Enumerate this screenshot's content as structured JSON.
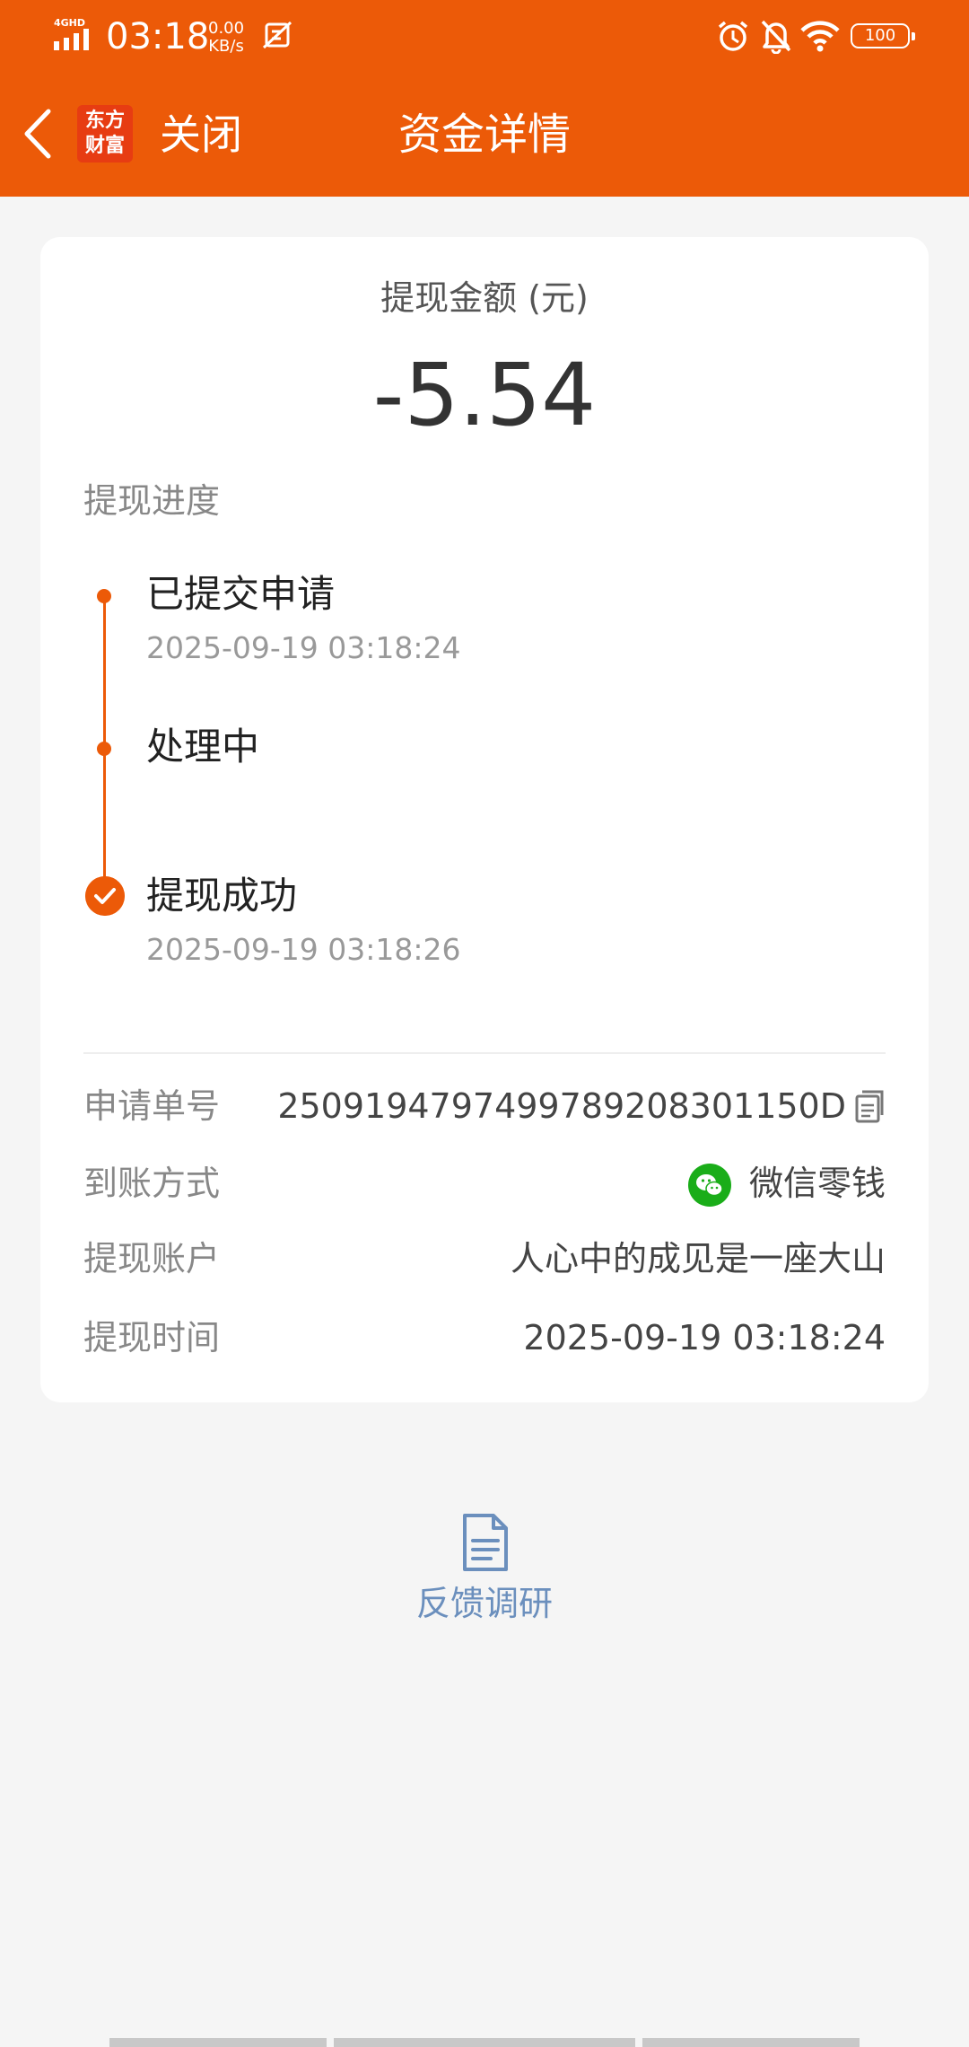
{
  "status_bar": {
    "network": "4GHD",
    "time": "03:18",
    "speed_value": "0.00",
    "speed_unit": "KB/s",
    "battery": "100"
  },
  "nav": {
    "logo_line1": "东方",
    "logo_line2": "财富",
    "close_label": "关闭",
    "title": "资金详情"
  },
  "withdraw": {
    "amount_label": "提现金额 (元)",
    "amount": "-5.54",
    "progress_title": "提现进度",
    "steps": [
      {
        "label": "已提交申请",
        "time": "2025-09-19 03:18:24"
      },
      {
        "label": "处理中",
        "time": ""
      },
      {
        "label": "提现成功",
        "time": "2025-09-19 03:18:26"
      }
    ]
  },
  "details": {
    "order_no_label": "申请单号",
    "order_no": "2509194797499789208301150D",
    "method_label": "到账方式",
    "method": "微信零钱",
    "account_label": "提现账户",
    "account": "人心中的成见是一座大山",
    "time_label": "提现时间",
    "time": "2025-09-19 03:18:24"
  },
  "feedback": {
    "label": "反馈调研"
  },
  "colors": {
    "accent": "#ec5a08",
    "wechat": "#1aad19",
    "feedback": "#6b8fbd"
  }
}
